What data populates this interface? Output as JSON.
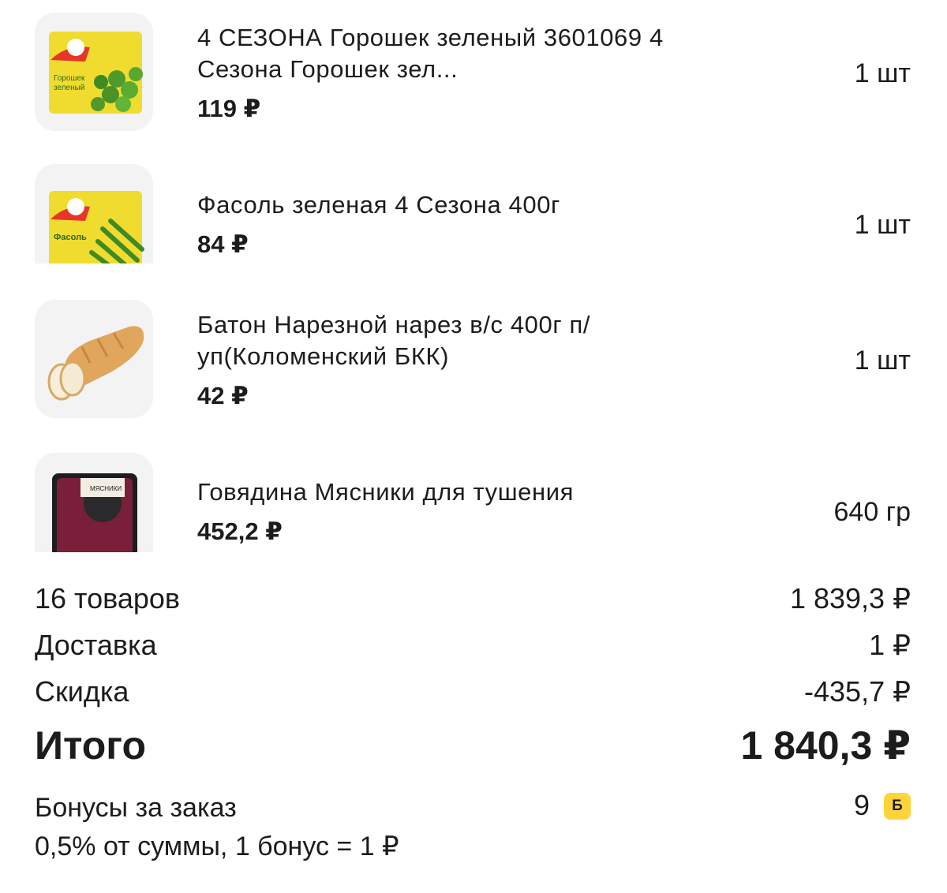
{
  "items": [
    {
      "name": "4 СЕЗОНА Горошек зеленый 3601069 4 Сезона Горошек зел...",
      "price": "119 ₽",
      "qty": "1 шт",
      "image_icon": "peas-package-icon"
    },
    {
      "name": "Фасоль зеленая 4 Сезона 400г",
      "price": "84 ₽",
      "qty": "1 шт",
      "image_icon": "green-beans-package-icon"
    },
    {
      "name": "Батон Нарезной нарез в/с 400г п/уп(Коломенский БКК)",
      "price": "42 ₽",
      "qty": "1 шт",
      "image_icon": "bread-loaf-icon"
    },
    {
      "name": "Говядина Мясники для тушения",
      "price": "452,2 ₽",
      "qty": "640 гр",
      "image_icon": "beef-package-icon"
    }
  ],
  "summary": {
    "goods_label": "16 товаров",
    "goods_value": "1 839,3 ₽",
    "delivery_label": "Доставка",
    "delivery_value": "1 ₽",
    "discount_label": "Скидка",
    "discount_value": "-435,7 ₽",
    "total_label": "Итого",
    "total_value": "1 840,3 ₽"
  },
  "bonus": {
    "label": "Бонусы за заказ",
    "note": "0,5% от суммы, 1 бонус = 1 ₽",
    "value": "9",
    "badge": "Б"
  },
  "colors": {
    "badge": "#ffd43b",
    "thumb_bg": "#f3f3f3"
  }
}
